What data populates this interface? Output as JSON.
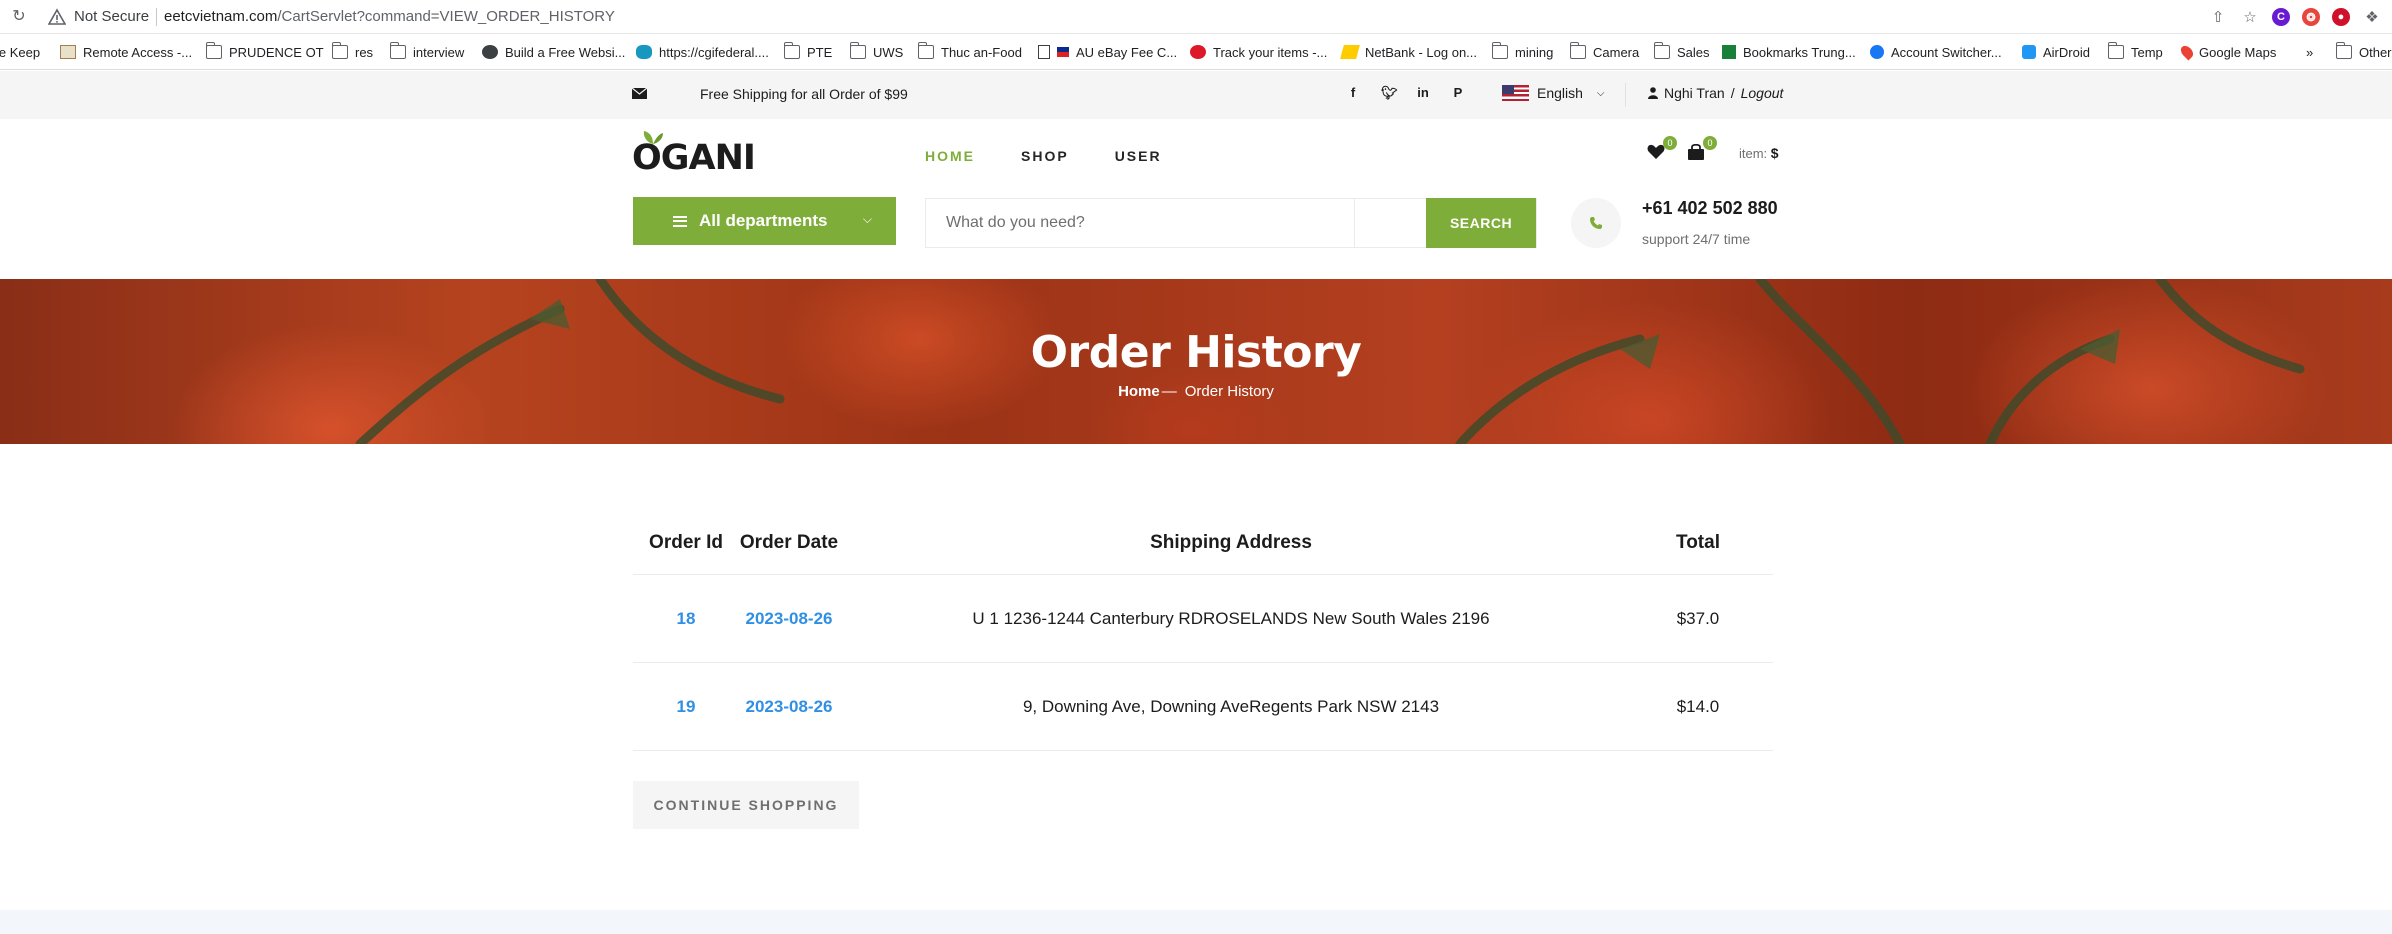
{
  "browser": {
    "security_label": "Not Secure",
    "url_host": "eetcvietnam.com",
    "url_path": "/CartServlet?command=VIEW_ORDER_HISTORY",
    "bookmarks": [
      "le Keep",
      "Remote Access -...",
      "PRUDENCE OT",
      "res",
      "interview",
      "Build a Free Websi...",
      "https://cgifederal....",
      "PTE",
      "UWS",
      "Thuc an-Food",
      "AU eBay Fee C...",
      "Track your items -...",
      "NetBank - Log on...",
      "mining",
      "Camera",
      "Sales",
      "Bookmarks Trung...",
      "Account Switcher...",
      "AirDroid",
      "Temp",
      "Google Maps",
      "»",
      "Other"
    ]
  },
  "topbar": {
    "shipping_text": "Free Shipping for all Order of $99",
    "language": "English",
    "user_name": "Nghi Tran",
    "separator": "/",
    "logout_label": "Logout"
  },
  "header": {
    "logo": "OGANI",
    "nav": [
      "HOME",
      "SHOP",
      "USER"
    ],
    "wishlist_count": "0",
    "cart_count": "0",
    "item_label": "item:",
    "item_price": "$",
    "departments_label": "All departments",
    "search_placeholder": "What do you need?",
    "search_button": "SEARCH",
    "phone": "+61 402 502 880",
    "support": "support 24/7 time"
  },
  "banner": {
    "title": "Order History",
    "crumb_home": "Home",
    "crumb_dash": "—",
    "crumb_current": "Order History"
  },
  "table": {
    "headers": [
      "Order Id",
      "Order Date",
      "Shipping Address",
      "Total"
    ],
    "rows": [
      {
        "id": "18",
        "date": "2023-08-26",
        "address": "U 1 1236-1244 Canterbury RDROSELANDS New South Wales 2196",
        "total": "$37.0"
      },
      {
        "id": "19",
        "date": "2023-08-26",
        "address": "9, Downing Ave, Downing AveRegents Park NSW 2143",
        "total": "$14.0"
      }
    ]
  },
  "continue_label": "CONTINUE SHOPPING",
  "colors": {
    "accent": "#7fad39",
    "link": "#2f8fe4",
    "text": "#1c1c1c"
  }
}
